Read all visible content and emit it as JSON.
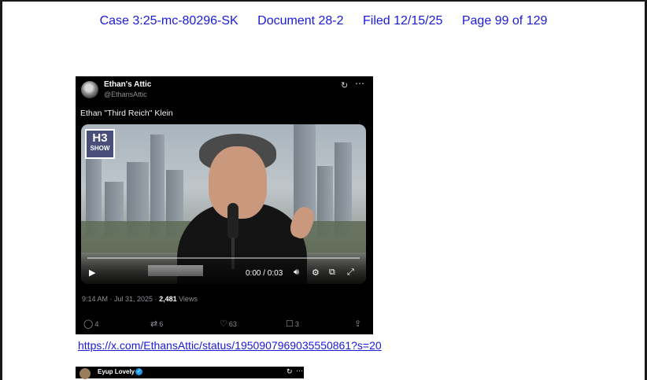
{
  "header": {
    "case": "Case 3:25-mc-80296-SK",
    "document": "Document 28-2",
    "filed": "Filed 12/15/25",
    "page": "Page 99 of 129"
  },
  "tweet": {
    "account_name": "Ethan's Attic",
    "handle": "@EthansAttic",
    "text": "Ethan \"Third Reich\" Klein",
    "video": {
      "logo_line1": "H3",
      "logo_line2": "SHOW",
      "time": "0:00 / 0:03"
    },
    "timestamp": "9:14 AM · Jul 31, 2025 · ",
    "views_count": "2,481",
    "views_label": " Views",
    "actions": {
      "replies": "4",
      "reposts": "6",
      "likes": "63",
      "bookmarks": "3"
    },
    "icons": {
      "grok": "grok-icon",
      "more": "more-icon",
      "reply": "reply-icon",
      "repost": "repost-icon",
      "like": "heart-icon",
      "bookmark": "bookmark-icon",
      "share": "share-icon"
    }
  },
  "link": "https://x.com/EthansAttic/status/1950907969035550861?s=20",
  "tweet2": {
    "account_name": "Eyup Lovely"
  },
  "colors": {
    "header_text": "#1a1adb",
    "link": "#1a1adb",
    "tweet_bg": "#000000",
    "verified": "#1d9bf0"
  }
}
